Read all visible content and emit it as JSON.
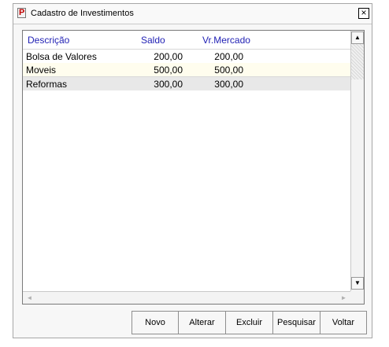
{
  "window": {
    "title": "Cadastro de Investimentos",
    "close_label": "×"
  },
  "grid": {
    "columns": [
      "Descrição",
      "Saldo",
      "Vr.Mercado"
    ],
    "rows": [
      {
        "descricao": "Bolsa de Valores",
        "saldo": "200,00",
        "vr_mercado": "200,00"
      },
      {
        "descricao": "Moveis",
        "saldo": "500,00",
        "vr_mercado": "500,00"
      },
      {
        "descricao": "Reformas",
        "saldo": "300,00",
        "vr_mercado": "300,00"
      }
    ]
  },
  "scrollbars": {
    "up_icon": "▲",
    "down_icon": "▼",
    "left_icon": "◄",
    "right_icon": "►"
  },
  "buttons": {
    "novo": "Novo",
    "alterar": "Alterar",
    "excluir": "Excluir",
    "pesquisar": "Pesquisar",
    "voltar": "Voltar"
  },
  "colors": {
    "header_text": "#1f1fb4",
    "selected_row": "#fffdee",
    "alt_row": "#e8e8e8"
  }
}
